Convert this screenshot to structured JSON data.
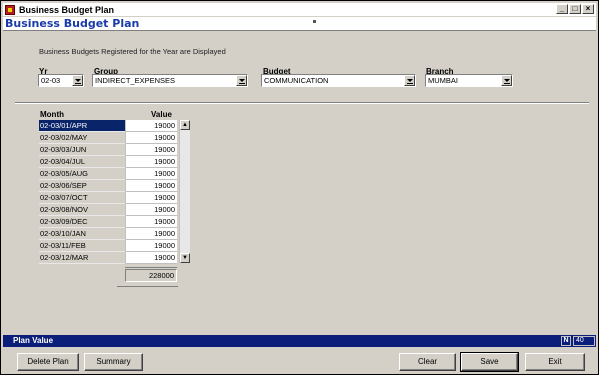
{
  "window": {
    "title": "Business Budget Plan",
    "controls": [
      "_",
      "□",
      "×"
    ]
  },
  "header": {
    "title": "Business Budget Plan"
  },
  "caption": "Business Budgets Registered for the Year are Displayed",
  "filters": {
    "year": {
      "label": "Yr",
      "value": "02-03"
    },
    "group": {
      "label": "Group",
      "value": "INDIRECT_EXPENSES"
    },
    "budget": {
      "label": "Budget",
      "value": "COMMUNICATION"
    },
    "branch": {
      "label": "Branch",
      "value": "MUMBAI"
    }
  },
  "grid": {
    "columns": [
      "Month",
      "Value"
    ],
    "rows": [
      {
        "month": "02-03/01/APR",
        "value": "19000"
      },
      {
        "month": "02-03/02/MAY",
        "value": "19000"
      },
      {
        "month": "02-03/03/JUN",
        "value": "19000"
      },
      {
        "month": "02-03/04/JUL",
        "value": "19000"
      },
      {
        "month": "02-03/05/AUG",
        "value": "19000"
      },
      {
        "month": "02-03/06/SEP",
        "value": "19000"
      },
      {
        "month": "02-03/07/OCT",
        "value": "19000"
      },
      {
        "month": "02-03/08/NOV",
        "value": "19000"
      },
      {
        "month": "02-03/09/DEC",
        "value": "19000"
      },
      {
        "month": "02-03/10/JAN",
        "value": "19000"
      },
      {
        "month": "02-03/11/FEB",
        "value": "19000"
      },
      {
        "month": "02-03/12/MAR",
        "value": "19000"
      }
    ],
    "total": "228000"
  },
  "status": {
    "text": "Plan Value",
    "mode": "N",
    "count": "40"
  },
  "buttons": {
    "delete_plan": "Delete Plan",
    "summary": "Summary",
    "clear": "Clear",
    "save": "Save",
    "exit": "Exit"
  },
  "colors": {
    "selection": "#0a246a",
    "status_bar": "#0a1e7a",
    "header_title": "#1a3aa8"
  }
}
